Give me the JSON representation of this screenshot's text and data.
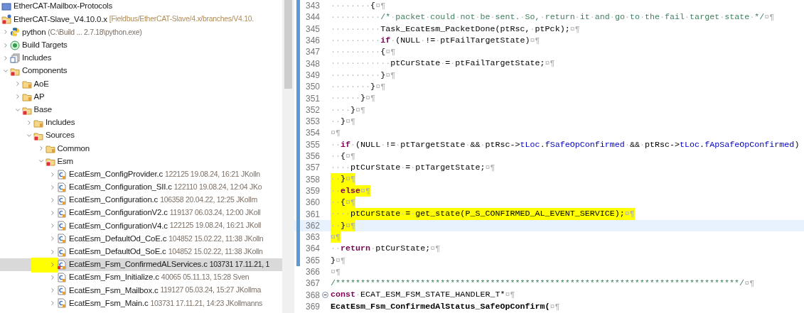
{
  "project_tree": [
    {
      "label": "EtherCAT-Mailbox-Protocols",
      "kind": "project-plain",
      "selected": false
    },
    {
      "label": "EtherCAT-Slave_V4.10.0.x",
      "decoration": "[Fieldbus/EtherCAT-Slave/4.x/branches/V4.10.",
      "kind": "project-c",
      "selected": false,
      "children": [
        {
          "label": "python",
          "decoration": "(C:\\Build ... 2.7.18\\python.exe)",
          "kind": "python",
          "expanded": false,
          "selected": false
        },
        {
          "label": "Build Targets",
          "kind": "target",
          "expanded": false,
          "selected": false
        },
        {
          "label": "Includes",
          "kind": "includes",
          "expanded": false,
          "selected": false
        },
        {
          "label": "Components",
          "kind": "source-folder",
          "expanded": true,
          "selected": false,
          "children": [
            {
              "label": "AoE",
              "kind": "folder",
              "expanded": false,
              "selected": false
            },
            {
              "label": "AP",
              "kind": "folder",
              "expanded": false,
              "selected": false
            },
            {
              "label": "Base",
              "kind": "source-folder",
              "expanded": true,
              "selected": false,
              "children": [
                {
                  "label": "Includes",
                  "kind": "folder",
                  "expanded": false,
                  "selected": false
                },
                {
                  "label": "Sources",
                  "kind": "source-folder",
                  "expanded": true,
                  "selected": false,
                  "children": [
                    {
                      "label": "Common",
                      "kind": "folder",
                      "expanded": false,
                      "selected": false
                    },
                    {
                      "label": "Esm",
                      "kind": "source-folder",
                      "expanded": true,
                      "selected": false,
                      "children": [
                        {
                          "label": "EcatEsm_ConfigProvider.c",
                          "decoration": "122125  19.08.24, 16:21  JKolln",
                          "kind": "c-file",
                          "expanded": false,
                          "selected": false
                        },
                        {
                          "label": "EcatEsm_Configuration_SII.c",
                          "decoration": "122110  19.08.24, 12:04  JKo",
                          "kind": "c-file",
                          "expanded": false,
                          "selected": false
                        },
                        {
                          "label": "EcatEsm_Configuration.c",
                          "decoration": "106358  20.04.22, 12:25  JKollm",
                          "kind": "c-file",
                          "expanded": false,
                          "selected": false
                        },
                        {
                          "label": "EcatEsm_ConfigurationV2.c",
                          "decoration": "119137  06.03.24, 12:00  JKoll",
                          "kind": "c-file",
                          "expanded": false,
                          "selected": false
                        },
                        {
                          "label": "EcatEsm_ConfigurationV4.c",
                          "decoration": "122125  19.08.24, 16:21  JKoll",
                          "kind": "c-file",
                          "expanded": false,
                          "selected": false
                        },
                        {
                          "label": "EcatEsm_DefaultOd_CoE.c",
                          "decoration": "104852  15.02.22, 11:38  JKolln",
                          "kind": "c-file",
                          "expanded": false,
                          "selected": false
                        },
                        {
                          "label": "EcatEsm_DefaultOd_SoE.c",
                          "decoration": "104852  15.02.22, 11:38  JKolln",
                          "kind": "c-file",
                          "expanded": false,
                          "selected": false
                        },
                        {
                          "label": "EcatEsm_Fsm_ConfirmedALServices.c",
                          "decoration": "103731  17.11.21, 1",
                          "kind": "c-file-error",
                          "expanded": false,
                          "selected": true,
                          "highlighted": true
                        },
                        {
                          "label": "EcatEsm_Fsm_Initialize.c",
                          "decoration": "40065  05.11.13, 15:28  Sven",
                          "kind": "c-file",
                          "expanded": false,
                          "selected": false
                        },
                        {
                          "label": "EcatEsm_Fsm_Mailbox.c",
                          "decoration": "119127  05.03.24, 15:27  JKollma",
                          "kind": "c-file",
                          "expanded": false,
                          "selected": false
                        },
                        {
                          "label": "EcatEsm_Fsm_Main.c",
                          "decoration": "103731  17.11.21, 14:23  JKollmanns",
                          "kind": "c-file",
                          "expanded": false,
                          "selected": false
                        }
                      ]
                    }
                  ]
                }
              ]
            }
          ]
        }
      ]
    }
  ],
  "editor": {
    "lines": [
      {
        "number": "343",
        "range_marker": true,
        "tokens": [
          {
            "kind": "plain",
            "text": "········{"
          },
          {
            "kind": "eol",
            "text": "¤¶"
          }
        ]
      },
      {
        "number": "344",
        "range_marker": true,
        "tokens": [
          {
            "kind": "plain",
            "text": "··········"
          },
          {
            "kind": "comment",
            "text": "/*·packet·could·not·be·sent.·So,·return·it·and·go·to·the·fail·target·state·*/"
          },
          {
            "kind": "eol",
            "text": "¤¶"
          }
        ]
      },
      {
        "number": "345",
        "range_marker": true,
        "tokens": [
          {
            "kind": "plain",
            "text": "··········Task_EcatEsm_PacketDone(ptRsc,·ptPck);"
          },
          {
            "kind": "eol",
            "text": "¤¶"
          }
        ]
      },
      {
        "number": "346",
        "range_marker": true,
        "tokens": [
          {
            "kind": "plain",
            "text": "··········"
          },
          {
            "kind": "keyword",
            "text": "if"
          },
          {
            "kind": "plain",
            "text": "·(NULL·!=·ptFailTargetState)"
          },
          {
            "kind": "eol",
            "text": "¤¶"
          }
        ]
      },
      {
        "number": "347",
        "range_marker": true,
        "tokens": [
          {
            "kind": "plain",
            "text": "··········{"
          },
          {
            "kind": "eol",
            "text": "¤¶"
          }
        ]
      },
      {
        "number": "348",
        "range_marker": true,
        "tokens": [
          {
            "kind": "plain",
            "text": "············ptCurState·=·ptFailTargetState;"
          },
          {
            "kind": "eol",
            "text": "¤¶"
          }
        ]
      },
      {
        "number": "349",
        "range_marker": true,
        "tokens": [
          {
            "kind": "plain",
            "text": "··········}"
          },
          {
            "kind": "eol",
            "text": "¤¶"
          }
        ]
      },
      {
        "number": "350",
        "range_marker": true,
        "tokens": [
          {
            "kind": "plain",
            "text": "········}"
          },
          {
            "kind": "eol",
            "text": "¤¶"
          }
        ]
      },
      {
        "number": "351",
        "range_marker": true,
        "tokens": [
          {
            "kind": "plain",
            "text": "······}"
          },
          {
            "kind": "eol",
            "text": "¤¶"
          }
        ]
      },
      {
        "number": "352",
        "range_marker": true,
        "tokens": [
          {
            "kind": "plain",
            "text": "····}"
          },
          {
            "kind": "eol",
            "text": "¤¶"
          }
        ]
      },
      {
        "number": "353",
        "range_marker": true,
        "tokens": [
          {
            "kind": "plain",
            "text": "··}"
          },
          {
            "kind": "eol",
            "text": "¤¶"
          }
        ]
      },
      {
        "number": "354",
        "range_marker": true,
        "tokens": [
          {
            "kind": "eol",
            "text": "¤¶"
          }
        ]
      },
      {
        "number": "355",
        "range_marker": true,
        "tokens": [
          {
            "kind": "plain",
            "text": "··"
          },
          {
            "kind": "keyword",
            "text": "if"
          },
          {
            "kind": "plain",
            "text": "·(NULL·!=·ptTargetState·&&·ptRsc->"
          },
          {
            "kind": "field",
            "text": "tLoc"
          },
          {
            "kind": "plain",
            "text": "."
          },
          {
            "kind": "field",
            "text": "fSafeOpConfirmed"
          },
          {
            "kind": "plain",
            "text": "·&&·ptRsc->"
          },
          {
            "kind": "field",
            "text": "tLoc"
          },
          {
            "kind": "plain",
            "text": "."
          },
          {
            "kind": "field",
            "text": "fApSafeOpConfirmed"
          },
          {
            "kind": "plain",
            "text": ")"
          }
        ]
      },
      {
        "number": "356",
        "range_marker": true,
        "tokens": [
          {
            "kind": "plain",
            "text": "··{"
          },
          {
            "kind": "eol",
            "text": "¤¶"
          }
        ]
      },
      {
        "number": "357",
        "range_marker": true,
        "tokens": [
          {
            "kind": "plain",
            "text": "····ptCurState·=·ptTargetState;"
          },
          {
            "kind": "eol",
            "text": "¤¶"
          }
        ]
      },
      {
        "number": "358",
        "range_marker": true,
        "highlighted": true,
        "tokens": [
          {
            "kind": "plain",
            "text": "··}"
          },
          {
            "kind": "eol",
            "text": "¤¶"
          }
        ]
      },
      {
        "number": "359",
        "range_marker": true,
        "highlighted": true,
        "tokens": [
          {
            "kind": "plain",
            "text": "··"
          },
          {
            "kind": "keyword",
            "text": "else"
          },
          {
            "kind": "eol",
            "text": "¤¶"
          }
        ]
      },
      {
        "number": "360",
        "range_marker": true,
        "highlighted": true,
        "tokens": [
          {
            "kind": "plain",
            "text": "··{"
          },
          {
            "kind": "eol",
            "text": "¤¶"
          }
        ]
      },
      {
        "number": "361",
        "range_marker": true,
        "highlighted": true,
        "tokens": [
          {
            "kind": "plain",
            "text": "····ptCurState·=·get_state(P_S_CONFIRMED_AL_EVENT_SERVICE);"
          },
          {
            "kind": "eol",
            "text": "¤¶"
          }
        ]
      },
      {
        "number": "362",
        "range_marker": true,
        "highlighted": true,
        "current": true,
        "tokens": [
          {
            "kind": "plain",
            "text": "··}"
          },
          {
            "kind": "eol",
            "text": "¤¶"
          }
        ]
      },
      {
        "number": "363",
        "range_marker": true,
        "highlighted": true,
        "tokens": [
          {
            "kind": "eol",
            "text": "¤¶"
          }
        ]
      },
      {
        "number": "364",
        "range_marker": true,
        "tokens": [
          {
            "kind": "plain",
            "text": "··"
          },
          {
            "kind": "keyword",
            "text": "return"
          },
          {
            "kind": "plain",
            "text": "·ptCurState;"
          },
          {
            "kind": "eol",
            "text": "¤¶"
          }
        ]
      },
      {
        "number": "365",
        "range_marker": true,
        "tokens": [
          {
            "kind": "plain",
            "text": "}"
          },
          {
            "kind": "eol",
            "text": "¤¶"
          }
        ]
      },
      {
        "number": "366",
        "range_marker": false,
        "tokens": [
          {
            "kind": "eol",
            "text": "¤¶"
          }
        ]
      },
      {
        "number": "367",
        "range_marker": false,
        "tokens": [
          {
            "kind": "comment",
            "text": "/*********************************************************************************/"
          },
          {
            "kind": "eol",
            "text": "¤¶"
          }
        ]
      },
      {
        "number": "368",
        "range_marker": false,
        "foldable": true,
        "tokens": [
          {
            "kind": "keyword",
            "text": "const"
          },
          {
            "kind": "plain",
            "text": "·ECAT_ESM_FSM_STATE_HANDLER_T*"
          },
          {
            "kind": "eol",
            "text": "¤¶"
          }
        ]
      },
      {
        "number": "369",
        "range_marker": false,
        "tokens": [
          {
            "kind": "bold",
            "text": "EcatEsm_Fsm_ConfirmedAlStatus_SafeOpConfirm("
          },
          {
            "kind": "eol",
            "text": "¤¶"
          }
        ]
      }
    ]
  }
}
